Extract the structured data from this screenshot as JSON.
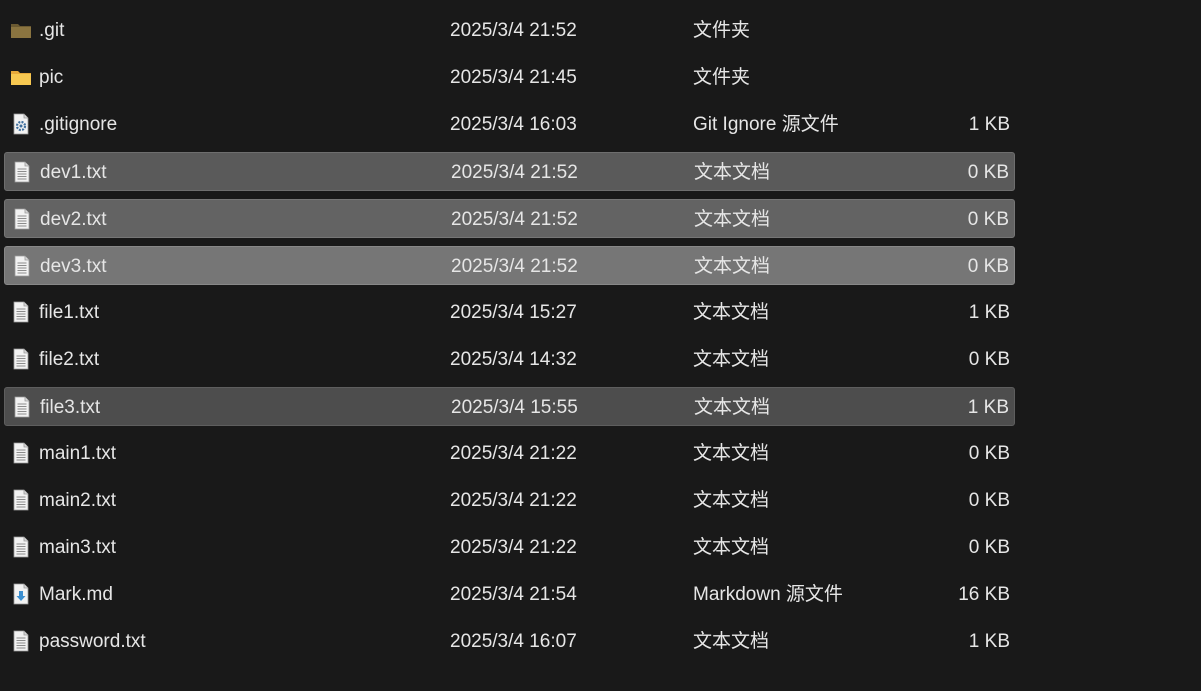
{
  "files": [
    {
      "name": ".git",
      "date": "2025/3/4 21:52",
      "type": "文件夹",
      "size": "",
      "icon": "folder-dark-icon",
      "state": "normal"
    },
    {
      "name": "pic",
      "date": "2025/3/4 21:45",
      "type": "文件夹",
      "size": "",
      "icon": "folder-icon",
      "state": "normal"
    },
    {
      "name": ".gitignore",
      "date": "2025/3/4 16:03",
      "type": "Git Ignore 源文件",
      "size": "1 KB",
      "icon": "gear-file-icon",
      "state": "normal"
    },
    {
      "name": "dev1.txt",
      "date": "2025/3/4 21:52",
      "type": "文本文档",
      "size": "0 KB",
      "icon": "text-file-icon",
      "state": "sel-dark"
    },
    {
      "name": "dev2.txt",
      "date": "2025/3/4 21:52",
      "type": "文本文档",
      "size": "0 KB",
      "icon": "text-file-icon",
      "state": "sel-mid"
    },
    {
      "name": "dev3.txt",
      "date": "2025/3/4 21:52",
      "type": "文本文档",
      "size": "0 KB",
      "icon": "text-file-icon",
      "state": "sel-light"
    },
    {
      "name": "file1.txt",
      "date": "2025/3/4 15:27",
      "type": "文本文档",
      "size": "1 KB",
      "icon": "text-file-icon",
      "state": "normal"
    },
    {
      "name": "file2.txt",
      "date": "2025/3/4 14:32",
      "type": "文本文档",
      "size": "0 KB",
      "icon": "text-file-icon",
      "state": "normal"
    },
    {
      "name": "file3.txt",
      "date": "2025/3/4 15:55",
      "type": "文本文档",
      "size": "1 KB",
      "icon": "text-file-icon",
      "state": "sel-soft"
    },
    {
      "name": "main1.txt",
      "date": "2025/3/4 21:22",
      "type": "文本文档",
      "size": "0 KB",
      "icon": "text-file-icon",
      "state": "normal"
    },
    {
      "name": "main2.txt",
      "date": "2025/3/4 21:22",
      "type": "文本文档",
      "size": "0 KB",
      "icon": "text-file-icon",
      "state": "normal"
    },
    {
      "name": "main3.txt",
      "date": "2025/3/4 21:22",
      "type": "文本文档",
      "size": "0 KB",
      "icon": "text-file-icon",
      "state": "normal"
    },
    {
      "name": "Mark.md",
      "date": "2025/3/4 21:54",
      "type": "Markdown 源文件",
      "size": "16 KB",
      "icon": "markdown-file-icon",
      "state": "normal"
    },
    {
      "name": "password.txt",
      "date": "2025/3/4 16:07",
      "type": "文本文档",
      "size": "1 KB",
      "icon": "text-file-icon",
      "state": "normal"
    }
  ],
  "colors": {
    "background": "#191919",
    "text": "#e6e6e6",
    "folder": "#f3c14c",
    "folder_dark": "#8a7440"
  }
}
